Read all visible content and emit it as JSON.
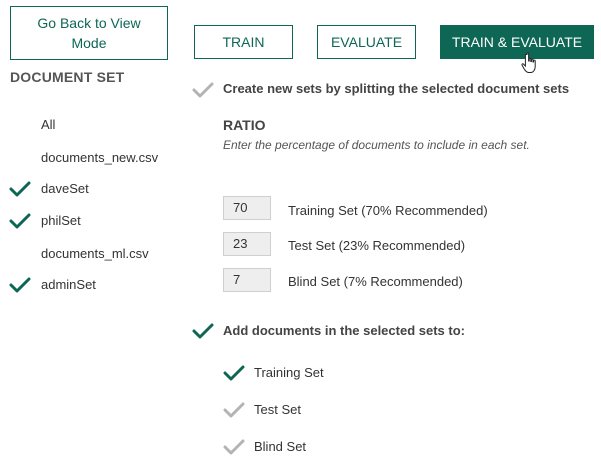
{
  "header": {
    "back_label": "Go Back to View Mode",
    "train_label": "TRAIN",
    "evaluate_label": "EVALUATE",
    "train_evaluate_label": "TRAIN & EVALUATE"
  },
  "sidebar": {
    "title": "DOCUMENT SET",
    "items": [
      {
        "label": "All",
        "checked": false
      },
      {
        "label": "documents_new.csv",
        "checked": false
      },
      {
        "label": "daveSet",
        "checked": true
      },
      {
        "label": "philSet",
        "checked": true
      },
      {
        "label": "documents_ml.csv",
        "checked": false
      },
      {
        "label": "adminSet",
        "checked": true
      }
    ]
  },
  "main": {
    "split_option_label": "Create new sets by splitting the selected document sets",
    "split_option_checked": false,
    "ratio": {
      "title": "RATIO",
      "description": "Enter the percentage of documents to include in each set.",
      "rows": [
        {
          "value": "70",
          "label": "Training Set  (70% Recommended)"
        },
        {
          "value": "23",
          "label": "Test Set  (23% Recommended)"
        },
        {
          "value": "7",
          "label": "Blind Set  (7% Recommended)"
        }
      ]
    },
    "add_option_label": "Add documents in the selected sets to:",
    "add_option_checked": true,
    "add_targets": [
      {
        "label": "Training Set",
        "checked": true
      },
      {
        "label": "Test Set",
        "checked": false
      },
      {
        "label": "Blind Set",
        "checked": false
      }
    ]
  },
  "colors": {
    "accent": "#0e6655",
    "check_inactive": "#b3b3b3"
  }
}
